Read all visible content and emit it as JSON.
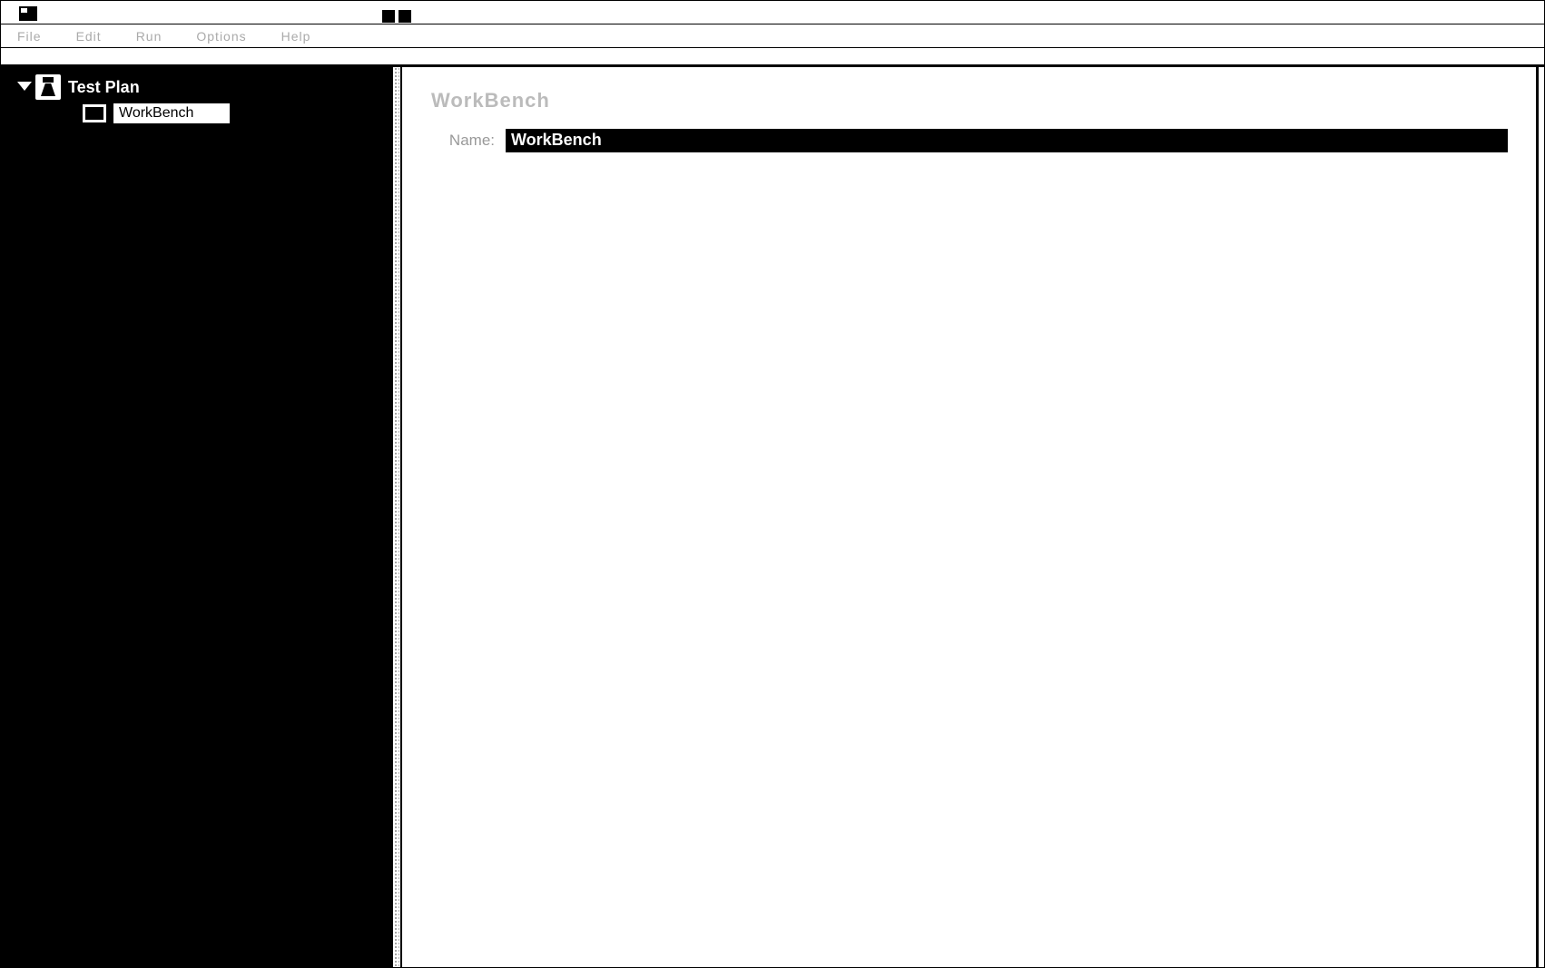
{
  "menubar": {
    "items": [
      "File",
      "Edit",
      "Run",
      "Options",
      "Help"
    ]
  },
  "tree": {
    "root_label": "Test Plan",
    "child_label": "WorkBench"
  },
  "panel": {
    "heading": "WorkBench",
    "name_label": "Name:",
    "name_value": "WorkBench"
  }
}
